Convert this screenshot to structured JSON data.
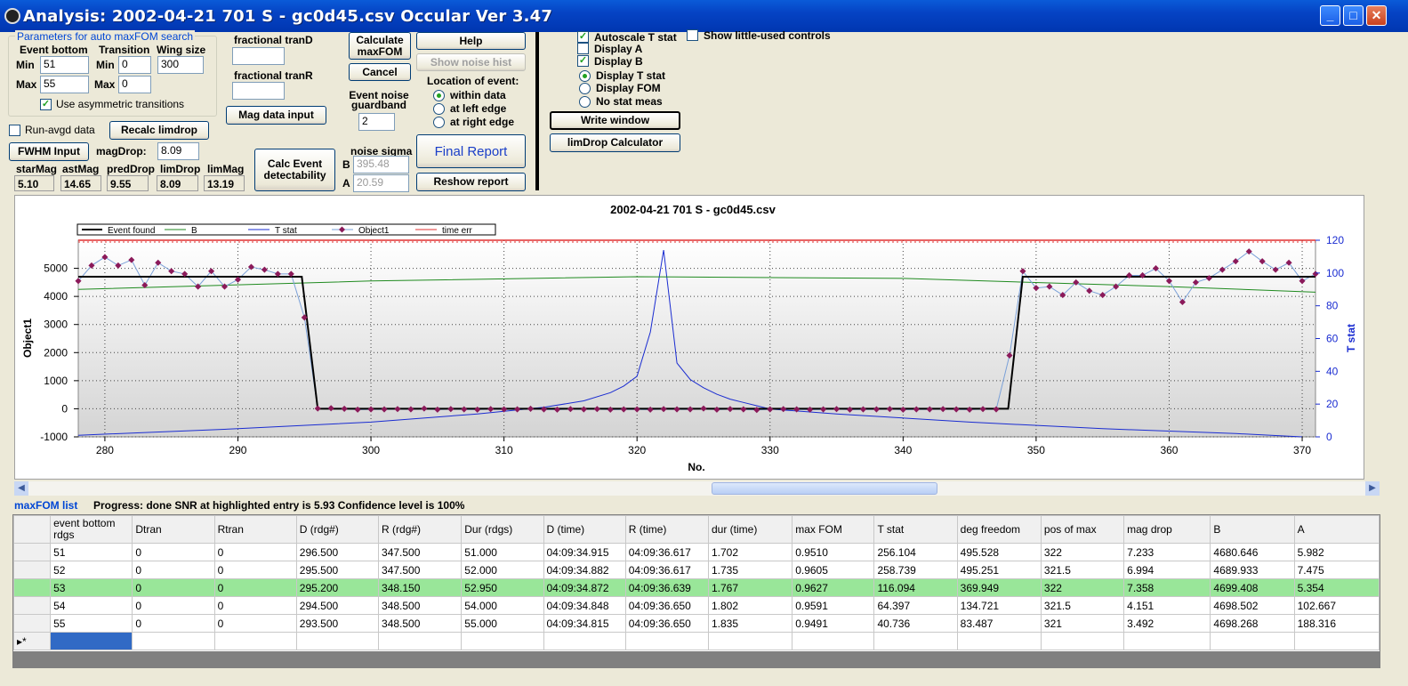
{
  "window": {
    "title": "Analysis: 2002-04-21 701 S - gc0d45.csv  Occular Ver 3.47"
  },
  "params": {
    "group_title": "Parameters for auto maxFOM search",
    "event_bottom_label": "Event bottom",
    "transition_label": "Transition",
    "wing_size_label": "Wing size",
    "min_label": "Min",
    "max_label": "Max",
    "event_bottom_min": "51",
    "event_bottom_max": "55",
    "transition_min": "0",
    "transition_max": "0",
    "wing_size": "300",
    "use_asym_label": "Use asymmetric transitions"
  },
  "controls": {
    "fractional_tranD": "fractional tranD",
    "fractional_tranR": "fractional tranR",
    "mag_data_input": "Mag data input",
    "calculate_maxfom": "Calculate maxFOM",
    "cancel": "Cancel",
    "help": "Help",
    "show_noise_hist": "Show noise hist",
    "event_noise_guardband": "Event noise guardband",
    "guardband_value": "2",
    "location_label": "Location of event:",
    "loc_within": "within data",
    "loc_left": "at left edge",
    "loc_right": "at right edge",
    "final_report": "Final Report",
    "reshow_report": "Reshow report",
    "noise_sigma": "noise sigma",
    "b_label": "B",
    "a_label": "A",
    "sigma_b": "395.48",
    "sigma_a": "20.59",
    "calc_event_detectability": "Calc Event detectability",
    "run_avgd": "Run-avgd data",
    "recalc_limdrop": "Recalc limdrop",
    "fwhm_input": "FWHM Input",
    "magdrop_label": "magDrop:",
    "magdrop_value": "8.09",
    "starmag_label": "starMag",
    "astmag_label": "astMag",
    "preddrop_label": "predDrop",
    "limdrop_label": "limDrop",
    "limmag_label": "limMag",
    "starmag": "5.10",
    "astmag": "14.65",
    "preddrop": "9.55",
    "limdrop": "8.09",
    "limmag": "13.19",
    "autoscale_t": "Autoscale T stat",
    "display_a": "Display A",
    "display_b": "Display B",
    "display_t": "Display T stat",
    "display_fom": "Display FOM",
    "no_stat": "No stat meas",
    "write_window": "Write window",
    "limdrop_calc": "limDrop Calculator",
    "show_little": "Show little-used controls"
  },
  "chart_data": {
    "type": "line",
    "title": "2002-04-21 701 S - gc0d45.csv",
    "xlabel": "No.",
    "ylabel": "Object1",
    "y2label": "T stat",
    "xlim": [
      278,
      371
    ],
    "ylim": [
      -1000,
      6000
    ],
    "y2lim": [
      0,
      120
    ],
    "x_ticks": [
      "280",
      "290",
      "300",
      "310",
      "320",
      "330",
      "340",
      "350",
      "360",
      "370"
    ],
    "y_ticks": [
      "-1000",
      "0",
      "1000",
      "2000",
      "3000",
      "4000",
      "5000"
    ],
    "y2_ticks": [
      "0",
      "20",
      "40",
      "60",
      "80",
      "100",
      "120"
    ],
    "legend": [
      "Event found",
      "B",
      "T stat",
      "Object1",
      "time err"
    ],
    "object1": {
      "x": [
        278,
        279,
        280,
        281,
        282,
        283,
        284,
        285,
        286,
        287,
        288,
        289,
        290,
        291,
        292,
        293,
        294,
        295,
        296,
        297,
        298,
        299,
        300,
        301,
        302,
        303,
        304,
        305,
        306,
        307,
        308,
        309,
        310,
        311,
        312,
        313,
        314,
        315,
        316,
        317,
        318,
        319,
        320,
        321,
        322,
        323,
        324,
        325,
        326,
        327,
        328,
        329,
        330,
        331,
        332,
        333,
        334,
        335,
        336,
        337,
        338,
        339,
        340,
        341,
        342,
        343,
        344,
        345,
        346,
        347,
        348,
        349,
        350,
        351,
        352,
        353,
        354,
        355,
        356,
        357,
        358,
        359,
        360,
        361,
        362,
        363,
        364,
        365,
        366,
        367,
        368,
        369,
        370,
        371
      ],
      "y": [
        4550,
        5100,
        5400,
        5100,
        5300,
        4400,
        5200,
        4900,
        4800,
        4350,
        4900,
        4350,
        4600,
        5050,
        4950,
        4800,
        4800,
        3250,
        10,
        20,
        0,
        -30,
        -20,
        -20,
        -10,
        -20,
        10,
        -30,
        -10,
        -20,
        -30,
        -10,
        -20,
        -20,
        0,
        -20,
        -30,
        -10,
        -20,
        -10,
        -30,
        -20,
        -20,
        -30,
        -10,
        -20,
        -20,
        10,
        -30,
        -10,
        -20,
        -40,
        -20,
        -10,
        -20,
        -30,
        -20,
        -10,
        -30,
        -20,
        -20,
        -10,
        -30,
        -20,
        -20,
        -10,
        -20,
        -30,
        -10,
        -20,
        1900,
        4900,
        4300,
        4350,
        4050,
        4500,
        4200,
        4050,
        4350,
        4750,
        4750,
        5000,
        4550,
        3800,
        4500,
        4650,
        4950,
        5250,
        5600,
        5250,
        4950,
        5200,
        4550,
        4800
      ]
    },
    "event_found": {
      "x": [
        278,
        294.8,
        296,
        347.9,
        349,
        371
      ],
      "y": [
        4700,
        4700,
        0,
        0,
        4700,
        4700
      ]
    },
    "b_line": {
      "x": [
        278,
        300,
        320,
        340,
        360,
        371
      ],
      "y": [
        4250,
        4550,
        4700,
        4640,
        4350,
        4150
      ]
    },
    "t_stat": {
      "x": [
        278,
        290,
        300,
        308,
        313,
        316,
        318,
        319,
        320,
        321,
        322,
        323,
        324,
        325,
        326,
        327,
        328,
        329,
        330,
        335,
        345,
        355,
        365,
        370
      ],
      "y": [
        1,
        5,
        9,
        14,
        18,
        22,
        27,
        31,
        37,
        64,
        114,
        45,
        35,
        30,
        26,
        23,
        21,
        19,
        17,
        14,
        9,
        5,
        2,
        0
      ]
    },
    "time_err": 6000
  },
  "status": {
    "list_label": "maxFOM list",
    "progress": "Progress: done  SNR at highlighted entry is 5.93   Confidence level is  100%"
  },
  "table": {
    "headers": [
      "event bottom rdgs",
      "Dtran",
      "Rtran",
      "D (rdg#)",
      "R (rdg#)",
      "Dur (rdgs)",
      "D (time)",
      "R (time)",
      "dur (time)",
      "max FOM",
      "T stat",
      "deg freedom",
      "pos of max",
      "mag drop",
      "B",
      "A"
    ],
    "rows": [
      [
        "51",
        "0",
        "0",
        "296.500",
        "347.500",
        "51.000",
        "04:09:34.915",
        "04:09:36.617",
        "1.702",
        "0.9510",
        "256.104",
        "495.528",
        "322",
        "7.233",
        "4680.646",
        "5.982"
      ],
      [
        "52",
        "0",
        "0",
        "295.500",
        "347.500",
        "52.000",
        "04:09:34.882",
        "04:09:36.617",
        "1.735",
        "0.9605",
        "258.739",
        "495.251",
        "321.5",
        "6.994",
        "4689.933",
        "7.475"
      ],
      [
        "53",
        "0",
        "0",
        "295.200",
        "348.150",
        "52.950",
        "04:09:34.872",
        "04:09:36.639",
        "1.767",
        "0.9627",
        "116.094",
        "369.949",
        "322",
        "7.358",
        "4699.408",
        "5.354"
      ],
      [
        "54",
        "0",
        "0",
        "294.500",
        "348.500",
        "54.000",
        "04:09:34.848",
        "04:09:36.650",
        "1.802",
        "0.9591",
        "64.397",
        "134.721",
        "321.5",
        "4.151",
        "4698.502",
        "102.667"
      ],
      [
        "55",
        "0",
        "0",
        "293.500",
        "348.500",
        "55.000",
        "04:09:34.815",
        "04:09:36.650",
        "1.835",
        "0.9491",
        "40.736",
        "83.487",
        "321",
        "3.492",
        "4698.268",
        "188.316"
      ]
    ],
    "new_row_marker": "▸*"
  }
}
